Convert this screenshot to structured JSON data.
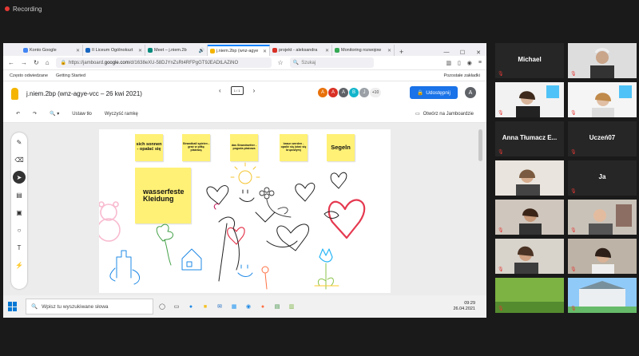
{
  "recording_label": "Recording",
  "browser": {
    "tabs": [
      {
        "title": "Konto Google",
        "color": "#4285f4"
      },
      {
        "title": "II Liceum Ogólnokszt",
        "color": "#1565c0"
      },
      {
        "title": "Meet – j.niem.2b",
        "color": "#00897b"
      },
      {
        "title": "j.niem.2bp (wnz-agye",
        "color": "#f4b400",
        "active": true
      },
      {
        "title": "projekt - aleksandra",
        "color": "#d93025"
      },
      {
        "title": "Monitoring rozwojow",
        "color": "#34a853"
      }
    ],
    "new_tab": "+",
    "url_prefix": "https://jamboard.",
    "url_domain": "google.com",
    "url_rest": "/d/1638eXU-58DJYnZsRt4RFPgGT9JEADtLAZiNO",
    "search_placeholder": "Szukaj",
    "bookmarks": [
      "Często odwiedzane",
      "Getting Started"
    ],
    "bookmarks_right": "Pozostałe zakładki"
  },
  "jamboard": {
    "title": "j.niem.2bp (wnz-agye-vcc – 26 kwi 2021)",
    "pager": "1 / 1",
    "avatars": [
      {
        "letter": "A",
        "color": "#e8710a"
      },
      {
        "letter": "A",
        "color": "#d93025"
      },
      {
        "letter": "A",
        "color": "#5f6368"
      },
      {
        "letter": "B",
        "color": "#12b5cb"
      },
      {
        "letter": "J",
        "color": "#9aa0a6"
      }
    ],
    "avatar_more": "+10",
    "share_label": "Udostępnij",
    "me_letter": "A",
    "toolbar": {
      "set_background": "Ustaw tło",
      "clear_frame": "Wyczyść ramkę",
      "open_in": "Otwórz na Jamboardzie"
    },
    "notes": [
      {
        "text": "sich sonnen - opalać się"
      },
      {
        "text": "Strandball spielen - grać w piłkę plażową"
      },
      {
        "text": "das Strandwetter - pogoda plażowa"
      },
      {
        "text": "braun werden - opalić się (stać się brązowym)"
      },
      {
        "text": "Segeln"
      },
      {
        "text": "wasserfeste Kleidung"
      }
    ]
  },
  "taskbar": {
    "search_placeholder": "Wpisz tu wyszukiwane słowa",
    "time": "09:29",
    "date": "26.04.2021"
  },
  "participants": [
    {
      "name": "Michael",
      "has_video": false
    },
    {
      "name": "",
      "has_video": true
    },
    {
      "name": "",
      "has_video": true
    },
    {
      "name": "",
      "has_video": true
    },
    {
      "name": "Anna Tłumacz E...",
      "has_video": false
    },
    {
      "name": "Uczeń07",
      "has_video": false
    },
    {
      "name": "",
      "has_video": true,
      "speaking": true
    },
    {
      "name": "Ja",
      "has_video": false
    },
    {
      "name": "",
      "has_video": true
    },
    {
      "name": "",
      "has_video": true
    },
    {
      "name": "",
      "has_video": true
    },
    {
      "name": "",
      "has_video": true
    },
    {
      "name": "",
      "has_video": true
    },
    {
      "name": "",
      "has_video": true
    }
  ]
}
